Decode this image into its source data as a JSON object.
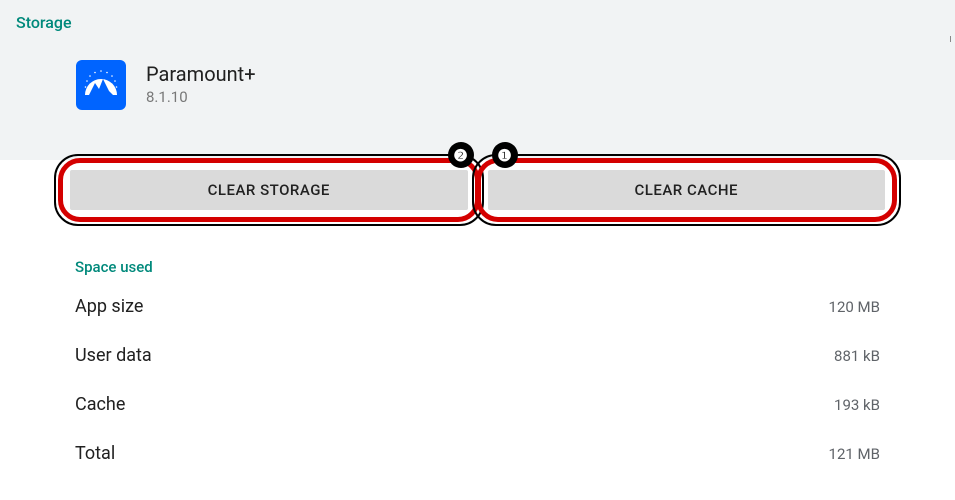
{
  "header": {
    "title": "Storage"
  },
  "app": {
    "name": "Paramount+",
    "version": "8.1.10"
  },
  "buttons": {
    "clear_storage": "CLEAR STORAGE",
    "clear_cache": "CLEAR CACHE"
  },
  "annotations": {
    "badge1": "❶",
    "badge2": "❷"
  },
  "section": {
    "title": "Space used"
  },
  "storage": [
    {
      "label": "App size",
      "value": "120 MB"
    },
    {
      "label": "User data",
      "value": "881 kB"
    },
    {
      "label": "Cache",
      "value": "193 kB"
    },
    {
      "label": "Total",
      "value": "121 MB"
    }
  ]
}
